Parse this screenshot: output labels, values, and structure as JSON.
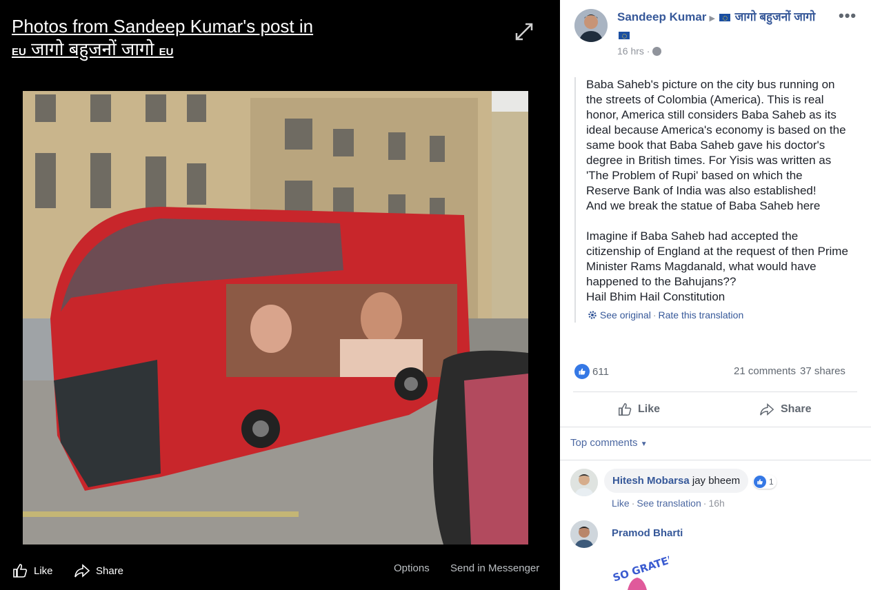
{
  "viewer": {
    "title_line1": "Photos from Sandeep Kumar's post in",
    "title_flag_left": "EU",
    "title_group": "जागो बहुजनों जागो",
    "title_flag_right": "EU",
    "footer": {
      "like_label": "Like",
      "share_label": "Share",
      "options_label": "Options",
      "messenger_label": "Send in Messenger"
    }
  },
  "post": {
    "author": "Sandeep Kumar",
    "group_name": "जागो बहुजनों जागो",
    "time": "16 hrs",
    "paragraph1": [
      "Baba Saheb's picture on the city bus running on",
      "the streets of Colombia (America). This is real",
      "honor, America still considers Baba Saheb as its",
      "ideal because America's economy is based on the",
      "same book that Baba Saheb gave his doctor's",
      "degree in British times. For Yisis was written as",
      "'The Problem of Rupi' based on which the",
      "Reserve Bank of India was also established!",
      "And we break the statue of Baba Saheb here"
    ],
    "paragraph2": [
      "Imagine if Baba Saheb had accepted the",
      "citizenship of England at the request of then Prime",
      "Minister Rams Magdanald, what would have",
      "happened to the Bahujans??",
      "Hail Bhim Hail Constitution"
    ],
    "see_original": "See original",
    "rate_translation": "Rate this translation",
    "like_count": "611",
    "comments": "21 comments",
    "shares": "37 shares",
    "like_label": "Like",
    "share_label": "Share"
  },
  "comments": {
    "filter_label": "Top comments",
    "items": [
      {
        "author": "Hitesh Mobarsa",
        "text": "jay bheem",
        "reaction_count": "1",
        "like_label": "Like",
        "see_translation": "See translation",
        "time": "16h"
      },
      {
        "author": "Pramod Bharti",
        "sticker_text": "SO GRATEFUL"
      }
    ]
  },
  "colors": {
    "link_blue": "#365899",
    "like_blue": "#3578e5",
    "viewer_bg": "#000000",
    "bus_red": "#c8262b"
  }
}
